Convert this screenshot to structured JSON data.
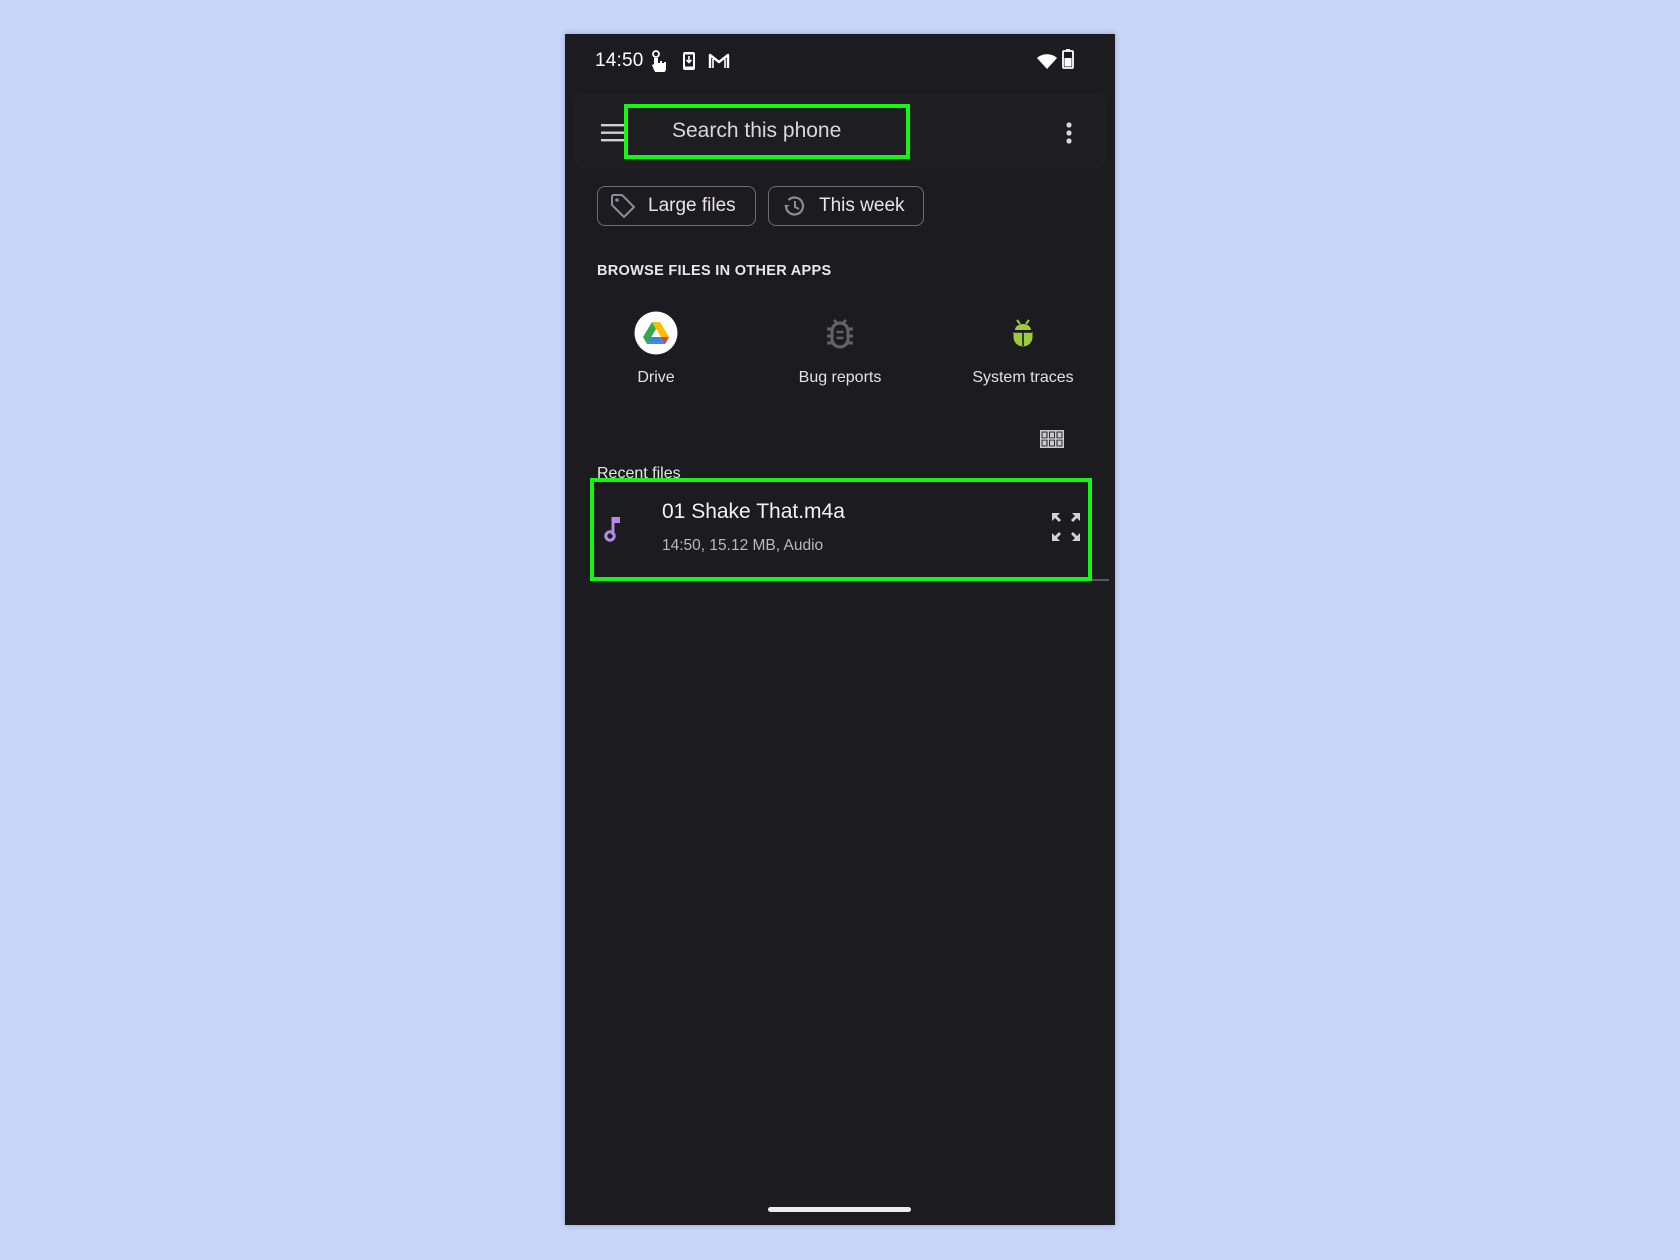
{
  "status_bar": {
    "time": "14:50",
    "left_icons": [
      "touch-app-icon",
      "download-to-device-icon",
      "gmail-icon"
    ],
    "right_icons": [
      "wifi-icon",
      "battery-icon"
    ]
  },
  "search": {
    "placeholder": "Search this phone",
    "menu_icon": "hamburger-menu-icon",
    "overflow_icon": "more-vert-icon"
  },
  "filter_chips": [
    {
      "label": "Large files",
      "icon": "tag-icon"
    },
    {
      "label": "This week",
      "icon": "history-icon"
    }
  ],
  "browse_section": {
    "title": "BROWSE FILES IN OTHER APPS",
    "apps": [
      {
        "label": "Drive",
        "icon": "google-drive-icon"
      },
      {
        "label": "Bug reports",
        "icon": "bug-icon"
      },
      {
        "label": "System traces",
        "icon": "android-bug-icon"
      }
    ]
  },
  "recent_files": {
    "title": "Recent files",
    "view_toggle_icon": "grid-view-icon",
    "items": [
      {
        "name": "01 Shake That.m4a",
        "meta": "14:50, 15.12 MB, Audio",
        "icon": "music-note-icon",
        "action_icon": "expand-icon"
      }
    ]
  },
  "highlight_color": "#13f713",
  "audio_icon_color": "#b58ae6",
  "system_traces_color": "#9ccb3c"
}
